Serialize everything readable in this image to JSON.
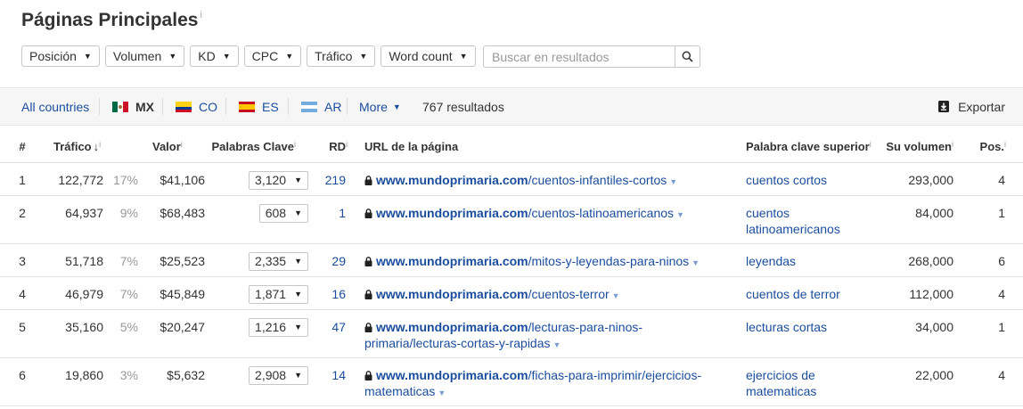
{
  "header": {
    "title": "Páginas Principales",
    "info_mark": "i"
  },
  "filters": [
    {
      "label": "Posición"
    },
    {
      "label": "Volumen"
    },
    {
      "label": "KD"
    },
    {
      "label": "CPC"
    },
    {
      "label": "Tráfico"
    },
    {
      "label": "Word count"
    }
  ],
  "search": {
    "placeholder": "Buscar en resultados",
    "value": ""
  },
  "countries": {
    "all_label": "All countries",
    "items": [
      {
        "code": "MX"
      },
      {
        "code": "CO"
      },
      {
        "code": "ES"
      },
      {
        "code": "AR"
      }
    ],
    "more_label": "More",
    "results": "767 resultados",
    "export_label": "Exportar"
  },
  "table": {
    "headers": {
      "num": "#",
      "traffic": "Tráfico",
      "value": "Valor",
      "keywords": "Palabras Clave",
      "rd": "RD",
      "url": "URL de la página",
      "top_kw": "Palabra clave superior",
      "volume": "Su volumen",
      "pos": "Pos."
    },
    "rows": [
      {
        "num": "1",
        "traffic": "122,772",
        "pct": "17%",
        "value": "$41,106",
        "kw": "3,120",
        "rd": "219",
        "domain": "www.mundoprimaria.com",
        "path": "/cuentos-infantiles-cortos",
        "path2": "",
        "top_kw": "cuentos cortos",
        "top_kw2": "",
        "volume": "293,000",
        "pos": "4"
      },
      {
        "num": "2",
        "traffic": "64,937",
        "pct": "9%",
        "value": "$68,483",
        "kw": "608",
        "rd": "1",
        "domain": "www.mundoprimaria.com",
        "path": "/cuentos-latinoamericanos",
        "path2": "",
        "top_kw": "cuentos",
        "top_kw2": "latinoamericanos",
        "volume": "84,000",
        "pos": "1"
      },
      {
        "num": "3",
        "traffic": "51,718",
        "pct": "7%",
        "value": "$25,523",
        "kw": "2,335",
        "rd": "29",
        "domain": "www.mundoprimaria.com",
        "path": "/mitos-y-leyendas-para-ninos",
        "path2": "",
        "top_kw": "leyendas",
        "top_kw2": "",
        "volume": "268,000",
        "pos": "6"
      },
      {
        "num": "4",
        "traffic": "46,979",
        "pct": "7%",
        "value": "$45,849",
        "kw": "1,871",
        "rd": "16",
        "domain": "www.mundoprimaria.com",
        "path": "/cuentos-terror",
        "path2": "",
        "top_kw": "cuentos de terror",
        "top_kw2": "",
        "volume": "112,000",
        "pos": "4"
      },
      {
        "num": "5",
        "traffic": "35,160",
        "pct": "5%",
        "value": "$20,247",
        "kw": "1,216",
        "rd": "47",
        "domain": "www.mundoprimaria.com",
        "path": "/lecturas-para-ninos-",
        "path2": "primaria/lecturas-cortas-y-rapidas",
        "top_kw": "lecturas cortas",
        "top_kw2": "",
        "volume": "34,000",
        "pos": "1"
      },
      {
        "num": "6",
        "traffic": "19,860",
        "pct": "3%",
        "value": "$5,632",
        "kw": "2,908",
        "rd": "14",
        "domain": "www.mundoprimaria.com",
        "path": "/fichas-para-imprimir/ejercicios-",
        "path2": "matematicas",
        "top_kw": "ejercicios de",
        "top_kw2": "matematicas",
        "volume": "22,000",
        "pos": "4"
      }
    ]
  }
}
